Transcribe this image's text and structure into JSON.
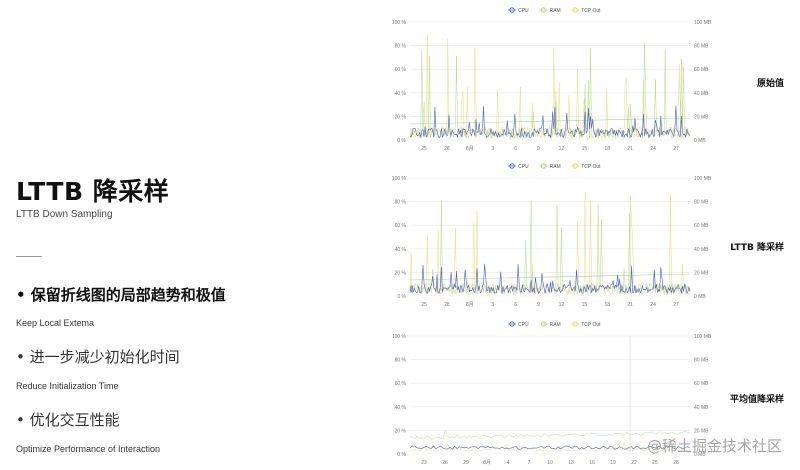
{
  "slide": {
    "title": "LTTB 降采样",
    "subtitle": "LTTB Down Sampling",
    "bullets": [
      {
        "text": "• 保留折线图的局部趋势和极值",
        "sub": "Keep Local Extema"
      },
      {
        "text": "• 进一步减少初始化时间",
        "sub": "Reduce Initialization Time"
      },
      {
        "text": "• 优化交互性能",
        "sub": "Optimize Performance of Interaction"
      }
    ],
    "watermark": "@稀土掘金技术社区"
  },
  "charts": [
    {
      "label": "原始值"
    },
    {
      "label": "LTTB 降采样"
    },
    {
      "label": "平均值降采样"
    }
  ],
  "legend": [
    "CPU",
    "RAM",
    "TCP Out"
  ],
  "colors": {
    "cpu": "#3b4cc0",
    "ram": "#a6cf6b",
    "tcp": "#e0d45a",
    "grid": "#e9e9e9"
  },
  "chart_data": [
    {
      "type": "line",
      "title": "原始值",
      "x": [
        "25",
        "28",
        "8月",
        "3",
        "6",
        "9",
        "12",
        "15",
        "18",
        "21",
        "24",
        "27"
      ],
      "y_left_ticks": [
        "0 %",
        "20 %",
        "40 %",
        "60 %",
        "80 %",
        "100 %"
      ],
      "y_right_ticks": [
        "0 MB",
        "20 MB",
        "40 MB",
        "60 MB",
        "80 MB",
        "100 MB"
      ],
      "series": [
        {
          "name": "CPU",
          "profile": "spiky-low",
          "peak": 30
        },
        {
          "name": "RAM",
          "profile": "spiky-high",
          "peak": 95
        },
        {
          "name": "TCP Out",
          "profile": "spiky-high",
          "peak": 90
        }
      ],
      "ylim": [
        0,
        100
      ]
    },
    {
      "type": "line",
      "title": "LTTB 降采样",
      "x": [
        "25",
        "28",
        "8月",
        "3",
        "6",
        "9",
        "12",
        "15",
        "18",
        "21",
        "24",
        "27"
      ],
      "y_left_ticks": [
        "0 %",
        "20 %",
        "40 %",
        "60 %",
        "80 %",
        "100 %"
      ],
      "y_right_ticks": [
        "0 MB",
        "20 MB",
        "40 MB",
        "60 MB",
        "80 MB",
        "100 MB"
      ],
      "series": [
        {
          "name": "CPU",
          "profile": "spiky-low",
          "peak": 30
        },
        {
          "name": "RAM",
          "profile": "spiky-high",
          "peak": 95
        },
        {
          "name": "TCP Out",
          "profile": "spiky-high",
          "peak": 90
        }
      ],
      "ylim": [
        0,
        100
      ]
    },
    {
      "type": "line",
      "title": "平均值降采样",
      "x": [
        "23",
        "26",
        "29",
        "8月",
        "4",
        "7",
        "10",
        "13",
        "16",
        "19",
        "22",
        "25",
        "28"
      ],
      "y_left_ticks": [
        "0 %",
        "20 %",
        "40 %",
        "60 %",
        "80 %",
        "100 %"
      ],
      "y_right_ticks": [
        "0 MB",
        "20 MB",
        "40 MB",
        "60 MB",
        "80 MB",
        "100 MB"
      ],
      "series": [
        {
          "name": "CPU",
          "profile": "flat-low",
          "peak": 12
        },
        {
          "name": "RAM",
          "profile": "flat-low",
          "peak": 22
        },
        {
          "name": "TCP Out",
          "profile": "flat-low",
          "peak": 15
        }
      ],
      "ylim": [
        0,
        100
      ]
    }
  ]
}
